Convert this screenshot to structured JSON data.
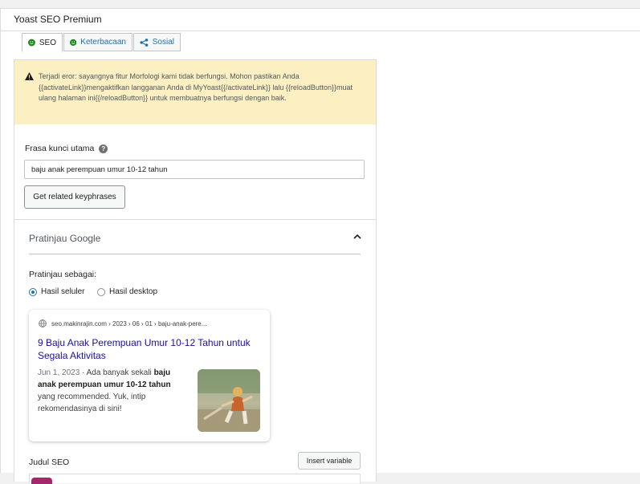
{
  "metabox": {
    "title": "Yoast SEO Premium"
  },
  "tabs": [
    {
      "label": "SEO",
      "icon": "smiley-icon",
      "active": true
    },
    {
      "label": "Keterbacaan",
      "icon": "smiley-icon",
      "active": false
    },
    {
      "label": "Sosial",
      "icon": "share-icon",
      "active": false
    }
  ],
  "warning": {
    "icon": "warning-icon",
    "text": "Terjadi eror: sayangnya fitur Morfologi kami tidak berfungsi. Mohon pastikan Anda {{activateLink}}mengaktifkan langganan Anda di MyYoast{{/activateLink}} lalu {{reloadButton}}muat ulang halaman ini{{/reloadButton}} untuk membuatnya berfungsi dengan baik."
  },
  "focus_keyphrase": {
    "label": "Frasa kunci utama",
    "value": "baju anak perempuan umur 10-12 tahun",
    "related_button": "Get related keyphrases"
  },
  "google_preview": {
    "title": "Pratinjau Google",
    "preview_as_label": "Pratinjau sebagai:",
    "options": [
      {
        "label": "Hasil seluler",
        "selected": true
      },
      {
        "label": "Hasil desktop",
        "selected": false
      }
    ],
    "serp": {
      "url": "seo.makinrajin.com › 2023 › 06 › 01 › baju-anak-pere...",
      "title": "9 Baju Anak Perempuan Umur 10-12 Tahun untuk Segala Aktivitas",
      "date": "Jun 1, 2023",
      "separator": " · ",
      "desc_before": "Ada banyak sekali ",
      "desc_bold": "baju anak perempuan umur 10-12 tahun",
      "desc_after": " yang recommended. Yuk, intip rekomendasinya di sini!"
    }
  },
  "seo_title": {
    "label": "Judul SEO",
    "insert_button": "Insert variable"
  },
  "colors": {
    "warning_bg": "#fcf0c3",
    "link": "#1a0dab",
    "accent": "#2271b1",
    "smiley_green": "#1a8a18",
    "variable_chip": "#a4286a"
  }
}
